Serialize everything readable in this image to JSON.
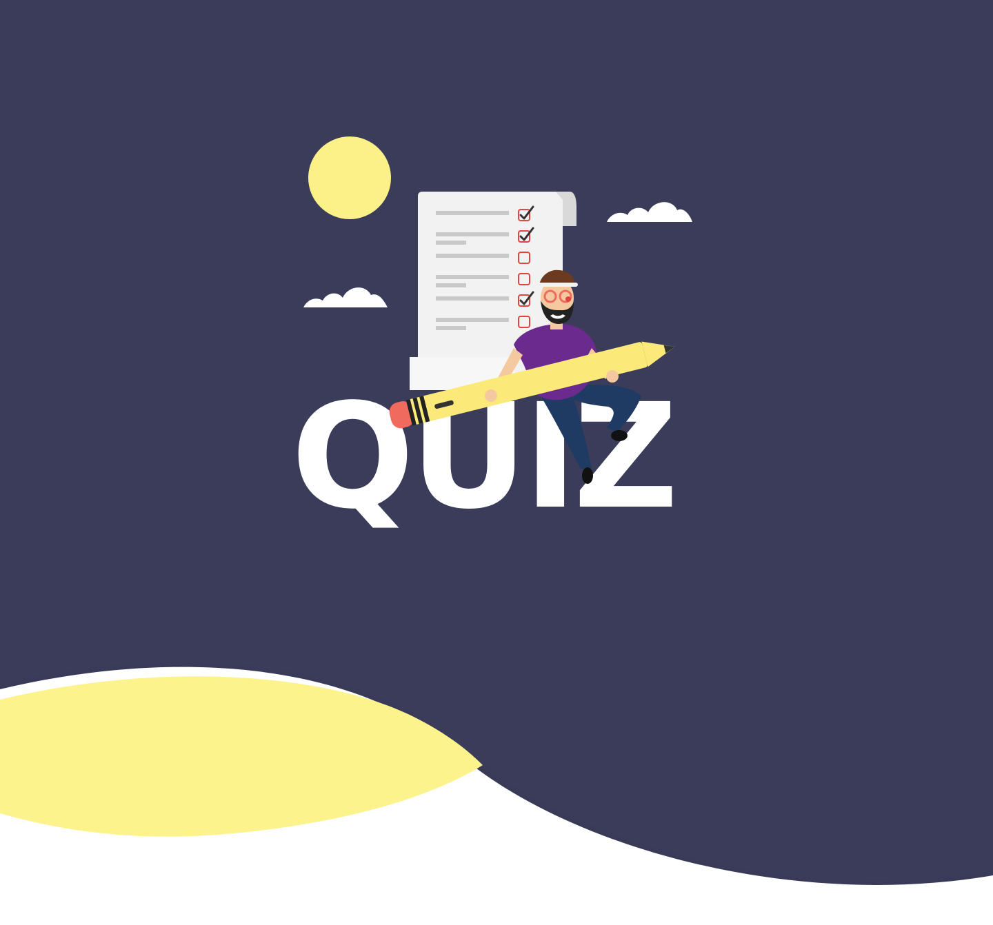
{
  "title": "QUIZ",
  "colors": {
    "background": "#3b3c5a",
    "sun": "#fcf089",
    "wave_yellow": "#fdf38d",
    "white": "#ffffff",
    "paper": "#f2f2f2",
    "paper_shadow": "#d9d9d9",
    "line": "#c9c9c9",
    "checkbox": "#e0443e",
    "check": "#333333",
    "shirt": "#6b2a8e",
    "jeans": "#1f3b63",
    "pencil": "#fbe97a",
    "eraser": "#f06a5e",
    "skin": "#f5c9a0",
    "beard": "#222222",
    "hat": "#6b3a1f"
  },
  "icons": [
    "sun-icon",
    "cloud-icon",
    "checklist-icon",
    "pencil-icon",
    "person-icon"
  ],
  "checklist": {
    "items": [
      {
        "checked": true
      },
      {
        "checked": true
      },
      {
        "checked": false
      },
      {
        "checked": false
      },
      {
        "checked": true
      },
      {
        "checked": false
      }
    ]
  }
}
